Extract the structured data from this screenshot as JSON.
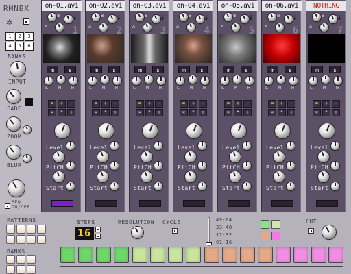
{
  "left_panel": {
    "logo": "RMNBX",
    "banks_label": "BANKS",
    "bank_keys": [
      "1",
      "2",
      "3",
      "4",
      "5",
      "6"
    ],
    "input_label": "INPUT",
    "fade_label": "FADE",
    "zoom_label": "ZOOM",
    "blur_label": "BLUR",
    "seq_label": "SEQ.\nON/OFF"
  },
  "channels": [
    {
      "title": "on-01.avi",
      "number": "1",
      "title_color": "normal",
      "bar_on": true
    },
    {
      "title": "on-02.avi",
      "number": "2",
      "title_color": "normal",
      "bar_on": false
    },
    {
      "title": "on-03.avi",
      "number": "3",
      "title_color": "normal",
      "bar_on": false
    },
    {
      "title": "on-04.avi",
      "number": "4",
      "title_color": "normal",
      "bar_on": false
    },
    {
      "title": "on-05.avi",
      "number": "5",
      "title_color": "normal",
      "bar_on": false
    },
    {
      "title": "on-06.avi",
      "number": "6",
      "title_color": "normal",
      "bar_on": false
    },
    {
      "title": "NOTHING",
      "number": "7",
      "title_color": "red",
      "bar_on": false
    }
  ],
  "channel_labels": {
    "a": "A",
    "b": "B",
    "m": "m",
    "s": "s",
    "l": "L",
    "mid": "M",
    "h": "H",
    "level": "Level",
    "pitch": "PitCH",
    "start": "Start"
  },
  "fx_symbols": [
    "=",
    "+",
    "-",
    "×",
    "*",
    "÷"
  ],
  "bottom": {
    "patterns_label": "PATTERNS",
    "banks_label": "BANKS",
    "steps_label": "STEPS",
    "steps_value": "16",
    "resolution_label": "RESOLUTION",
    "cycle_label": "CYCLE",
    "range_options": [
      "49-64",
      "33-48",
      "17-32",
      "01-16"
    ],
    "cut_label": "CUT"
  },
  "colors": {
    "channel_bg": "#5b5066",
    "active_bar": "#7a20c8",
    "led_text": "#f2d21b",
    "nothing_title": "#d11a1a"
  },
  "step_colors": [
    "#6fd66a",
    "#6fd66a",
    "#6fd66a",
    "#6fd66a",
    "#c9e49e",
    "#c9e49e",
    "#c9e49e",
    "#c9e49e",
    "#e4a88a",
    "#e4a88a",
    "#e4a88a",
    "#e4a88a",
    "#ee8fe2",
    "#ee8fe2",
    "#ee8fe2",
    "#ee8fe2"
  ],
  "swatch_colors": [
    "#8fe08a",
    "#d2e6b3",
    "#e3a98f",
    "#f07be3"
  ]
}
